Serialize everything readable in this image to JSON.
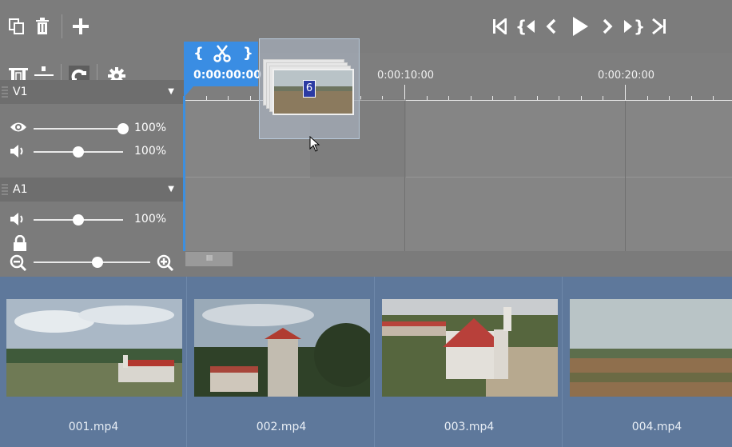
{
  "toolbar": {
    "left_buttons": [
      "copy-icon",
      "trash-icon",
      "plus-icon"
    ],
    "transport": [
      "skip-start-icon",
      "prev-marker-icon",
      "step-back-icon",
      "play-icon",
      "step-forward-icon",
      "next-marker-icon",
      "skip-end-icon"
    ]
  },
  "tools": [
    "ripple-icon",
    "split-icon",
    "magnet-icon",
    "gear-icon"
  ],
  "tracks": [
    {
      "name": "V1",
      "visibility_pct": "100%",
      "volume_pct": "100%",
      "visibility_level": 1.0,
      "volume_level": 0.5
    },
    {
      "name": "A1",
      "volume_pct": "100%",
      "volume_level": 0.5,
      "locked": true
    }
  ],
  "playhead": {
    "timecode": "0:00:00:00",
    "bracket_left": "{",
    "bracket_right": "}",
    "accent": "#3a8de3"
  },
  "ruler": {
    "labels": [
      "0:00:10:00",
      "0:00:20:00"
    ]
  },
  "drag": {
    "count": "6"
  },
  "zoom": {
    "level": 0.55
  },
  "scroll": {
    "grip": "IIII"
  },
  "bin": {
    "items": [
      {
        "name": "001.mp4"
      },
      {
        "name": "002.mp4"
      },
      {
        "name": "003.mp4"
      },
      {
        "name": "004.mp4"
      }
    ]
  },
  "colors": {
    "bin_bg": "#5e789b",
    "panel_bg": "#7c7c7c"
  }
}
